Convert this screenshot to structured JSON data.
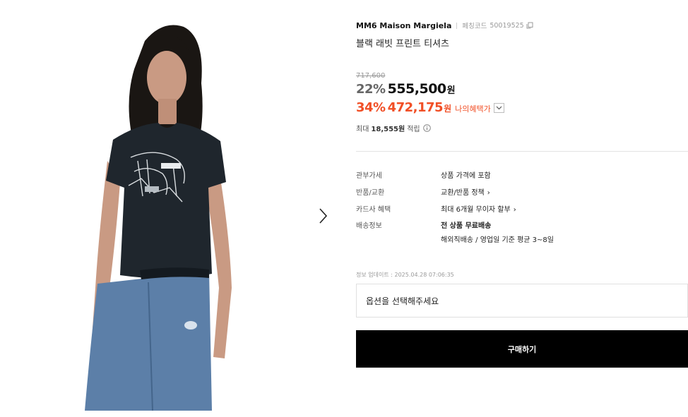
{
  "product": {
    "brand": "MM6 Maison Margiela",
    "code_label": "페칭코드",
    "code": "50019525",
    "name": "블랙 래빗 프린트 티셔츠",
    "image_icon": "model-photo",
    "next_icon": "chevron-right-icon"
  },
  "price": {
    "original": "717,600",
    "discount_rate": "22%",
    "sale_price": "555,500",
    "currency": "원",
    "benefit_rate": "34%",
    "benefit_price": "472,175",
    "benefit_currency": "원",
    "benefit_label": "나의혜택가",
    "points_prefix": "최대",
    "points_amount": "18,555원",
    "points_suffix": "적립"
  },
  "details": [
    {
      "label": "관부가세",
      "value": "상품 가격에 포함"
    },
    {
      "label": "반품/교환",
      "value": "교환/반품 정책"
    },
    {
      "label": "카드사 혜택",
      "value": "최대 6개월 무이자 할부"
    },
    {
      "label": "배송정보",
      "value": "전 상품 무료배송",
      "value2": "해외직배송 / 영업일 기준 평균 3~8일"
    }
  ],
  "update_info": "정보 업데이트 : 2025.04.28 07:06:35",
  "option_placeholder": "옵션을 선택해주세요",
  "buy_label": "구매하기",
  "colors": {
    "accent": "#f14f26",
    "buy_bg": "#000000",
    "tshirt": "#1f262d",
    "jeans": "#5c7fa8"
  }
}
